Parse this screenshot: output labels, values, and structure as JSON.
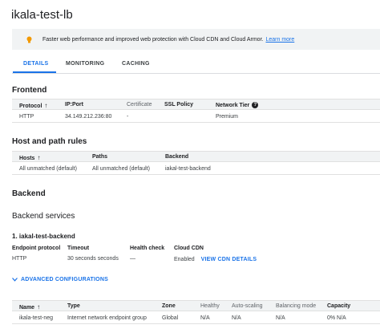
{
  "page": {
    "title": "ikala-test-lb"
  },
  "banner": {
    "icon": "lightbulb-icon",
    "icon_color": "#f29900",
    "text": "Faster web performance and improved web protection with Cloud CDN and Cloud Armor.",
    "link": "Learn more"
  },
  "tabs": [
    {
      "label": "DETAILS",
      "active": true
    },
    {
      "label": "MONITORING",
      "active": false
    },
    {
      "label": "CACHING",
      "active": false
    }
  ],
  "frontend": {
    "heading": "Frontend",
    "columns": [
      "Protocol",
      "IP:Port",
      "Certificate",
      "SSL Policy",
      "Network Tier"
    ],
    "row": [
      "HTTP",
      "34.149.212.236:80",
      "-",
      "",
      "Premium"
    ]
  },
  "host_rules": {
    "heading": "Host and path rules",
    "columns": [
      "Hosts",
      "Paths",
      "Backend"
    ],
    "row": [
      "All unmatched (default)",
      "All unmatched (default)",
      "iakal-test-backend"
    ]
  },
  "backend": {
    "heading": "Backend",
    "services_heading": "Backend services",
    "service_title": "1. iakal-test-backend",
    "fields": {
      "endpoint_protocol_label": "Endpoint protocol",
      "endpoint_protocol_value": "HTTP",
      "timeout_label": "Timeout",
      "timeout_value": "30 seconds seconds",
      "health_check_label": "Health check",
      "health_check_value": "—",
      "cloud_cdn_label": "Cloud CDN",
      "cloud_cdn_value": "Enabled",
      "cdn_link": "VIEW CDN DETAILS"
    },
    "advanced_link": "ADVANCED CONFIGURATIONS"
  },
  "neg_table": {
    "columns": [
      "Name",
      "Type",
      "Zone",
      "Healthy",
      "Auto-scaling",
      "Balancing mode",
      "Capacity"
    ],
    "row": [
      "ikala-test-neg",
      "Internet network endpoint group",
      "Global",
      "N/A",
      "N/A",
      "N/A",
      "0% N/A"
    ]
  },
  "colors": {
    "accent": "#1a73e8",
    "header_bg": "#f1f3f4"
  }
}
